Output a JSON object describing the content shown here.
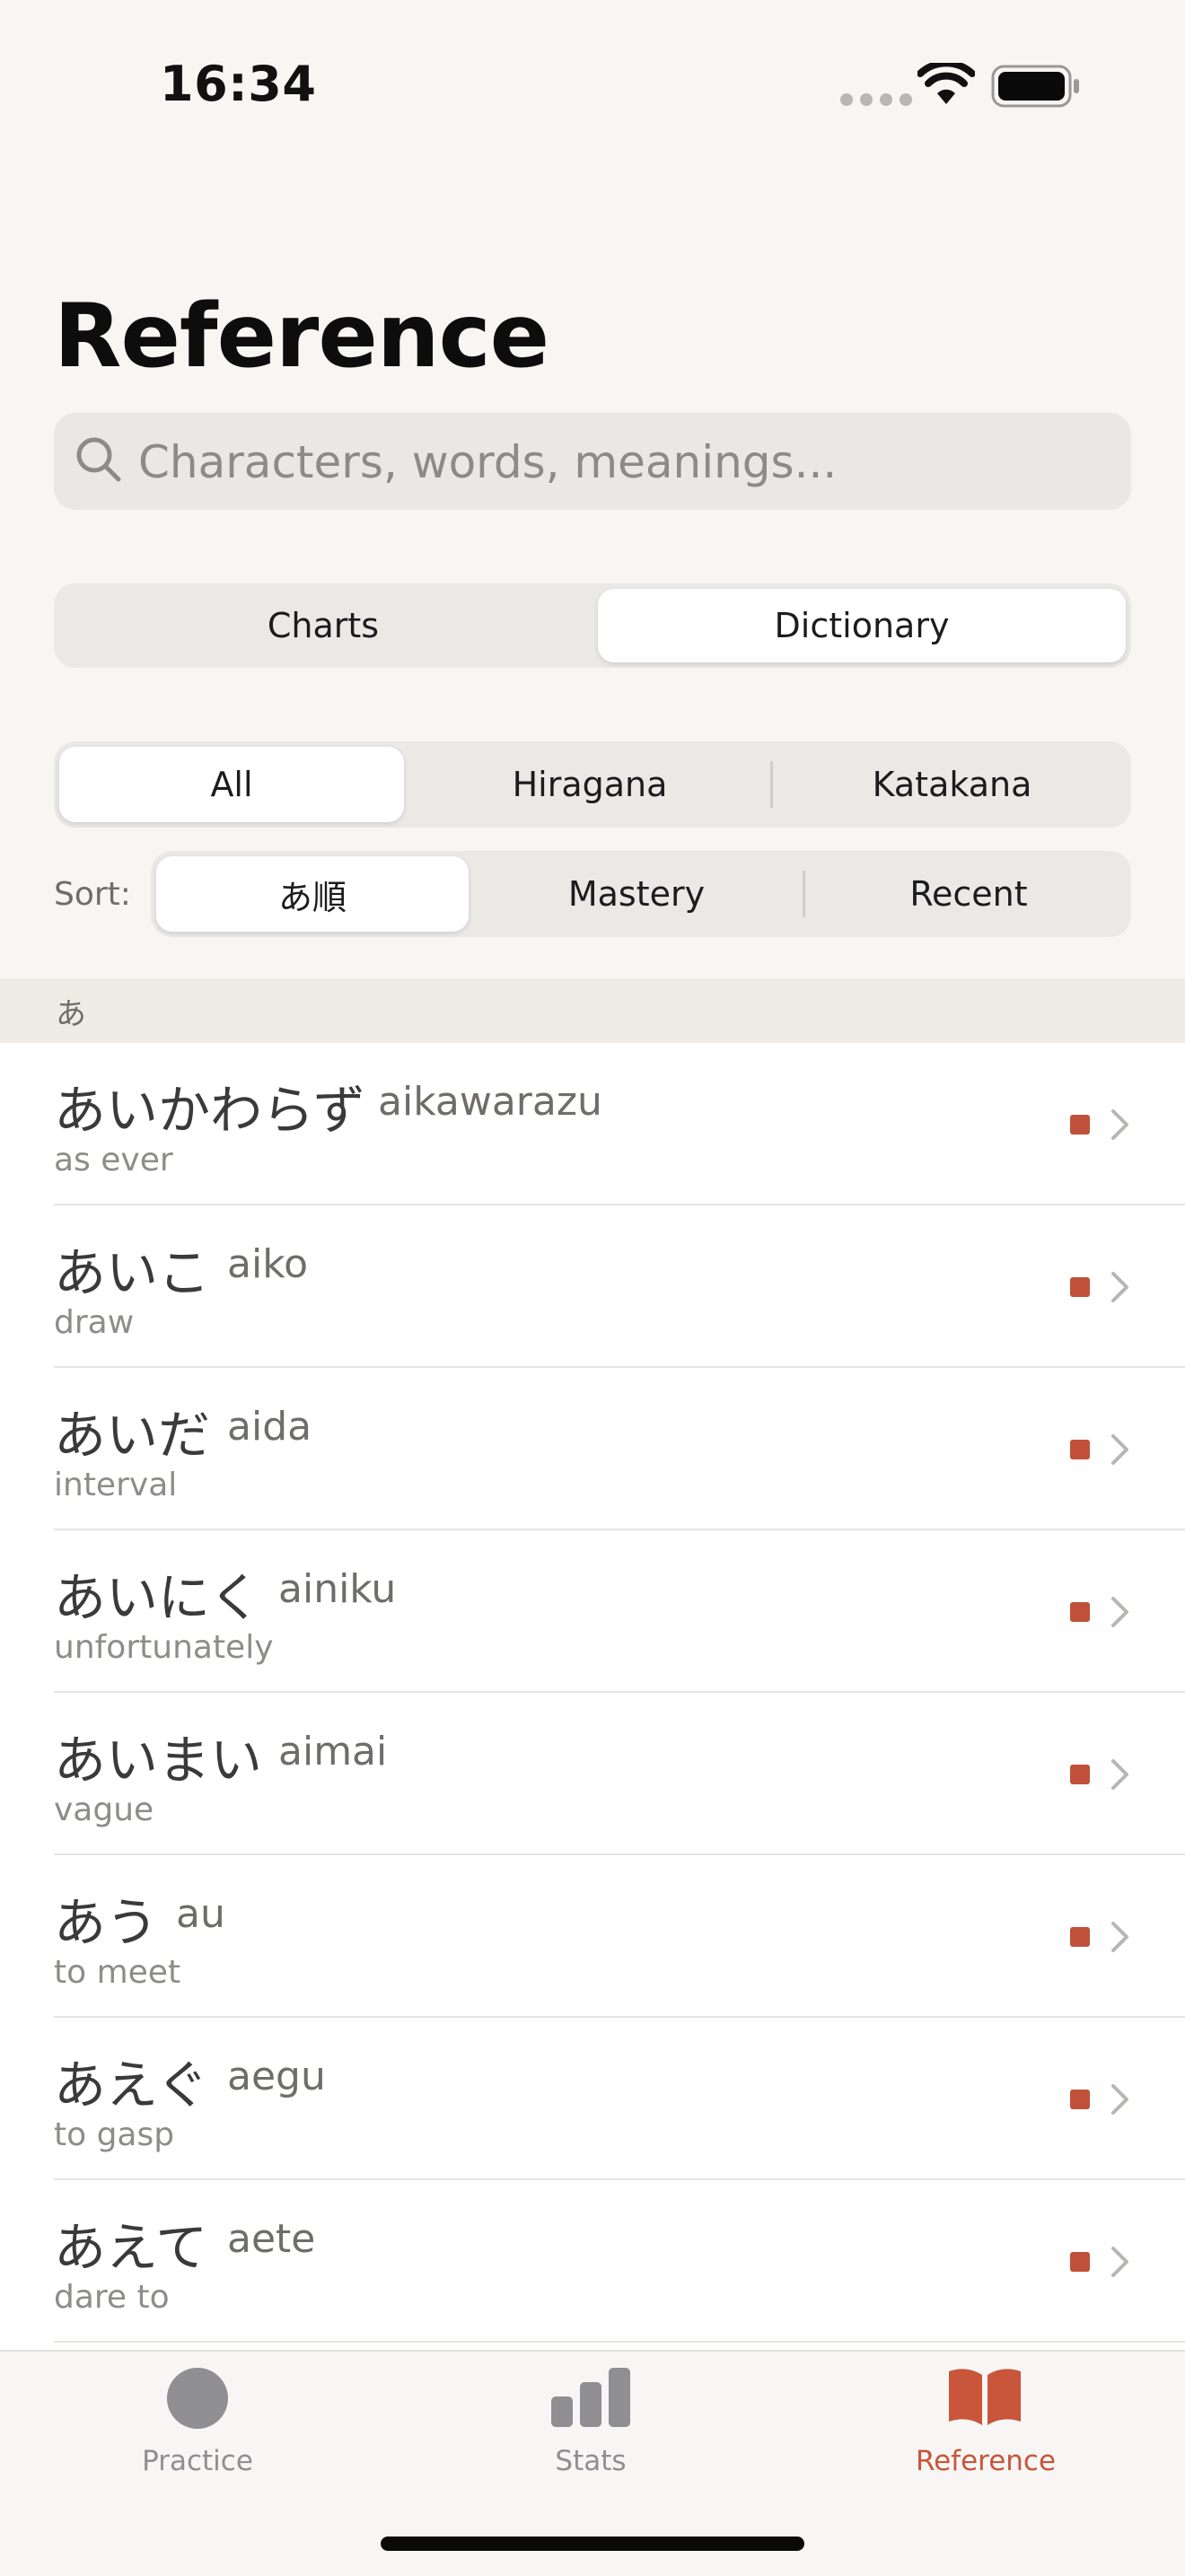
{
  "status_bar": {
    "time": "16:34"
  },
  "title": "Reference",
  "search": {
    "placeholder": "Characters, words, meanings..."
  },
  "view_tabs": [
    {
      "label": "Charts",
      "selected": false
    },
    {
      "label": "Dictionary",
      "selected": true
    }
  ],
  "filter_tabs": [
    {
      "label": "All",
      "selected": true
    },
    {
      "label": "Hiragana",
      "selected": false
    },
    {
      "label": "Katakana",
      "selected": false
    }
  ],
  "sort": {
    "label": "Sort:",
    "options": [
      {
        "label": "あ順",
        "selected": true
      },
      {
        "label": "Mastery",
        "selected": false
      },
      {
        "label": "Recent",
        "selected": false
      }
    ]
  },
  "section_header": "あ",
  "words": [
    {
      "kana": "あいかわらず",
      "romaji": "aikawarazu",
      "meaning": "as ever"
    },
    {
      "kana": "あいこ",
      "romaji": "aiko",
      "meaning": "draw"
    },
    {
      "kana": "あいだ",
      "romaji": "aida",
      "meaning": "interval"
    },
    {
      "kana": "あいにく",
      "romaji": "ainiku",
      "meaning": "unfortunately"
    },
    {
      "kana": "あいまい",
      "romaji": "aimai",
      "meaning": "vague"
    },
    {
      "kana": "あう",
      "romaji": "au",
      "meaning": "to meet"
    },
    {
      "kana": "あえぐ",
      "romaji": "aegu",
      "meaning": "to gasp"
    },
    {
      "kana": "あえて",
      "romaji": "aete",
      "meaning": "dare to"
    }
  ],
  "tab_bar": [
    {
      "label": "Practice",
      "icon": "circle-icon",
      "selected": false
    },
    {
      "label": "Stats",
      "icon": "bar-chart-icon",
      "selected": false
    },
    {
      "label": "Reference",
      "icon": "open-book-icon",
      "selected": true
    }
  ],
  "colors": {
    "accent": "#c9553a",
    "mastery_dot": "#c0503a",
    "tab_inactive": "#8e8e93",
    "background": "#f8f6f2"
  }
}
